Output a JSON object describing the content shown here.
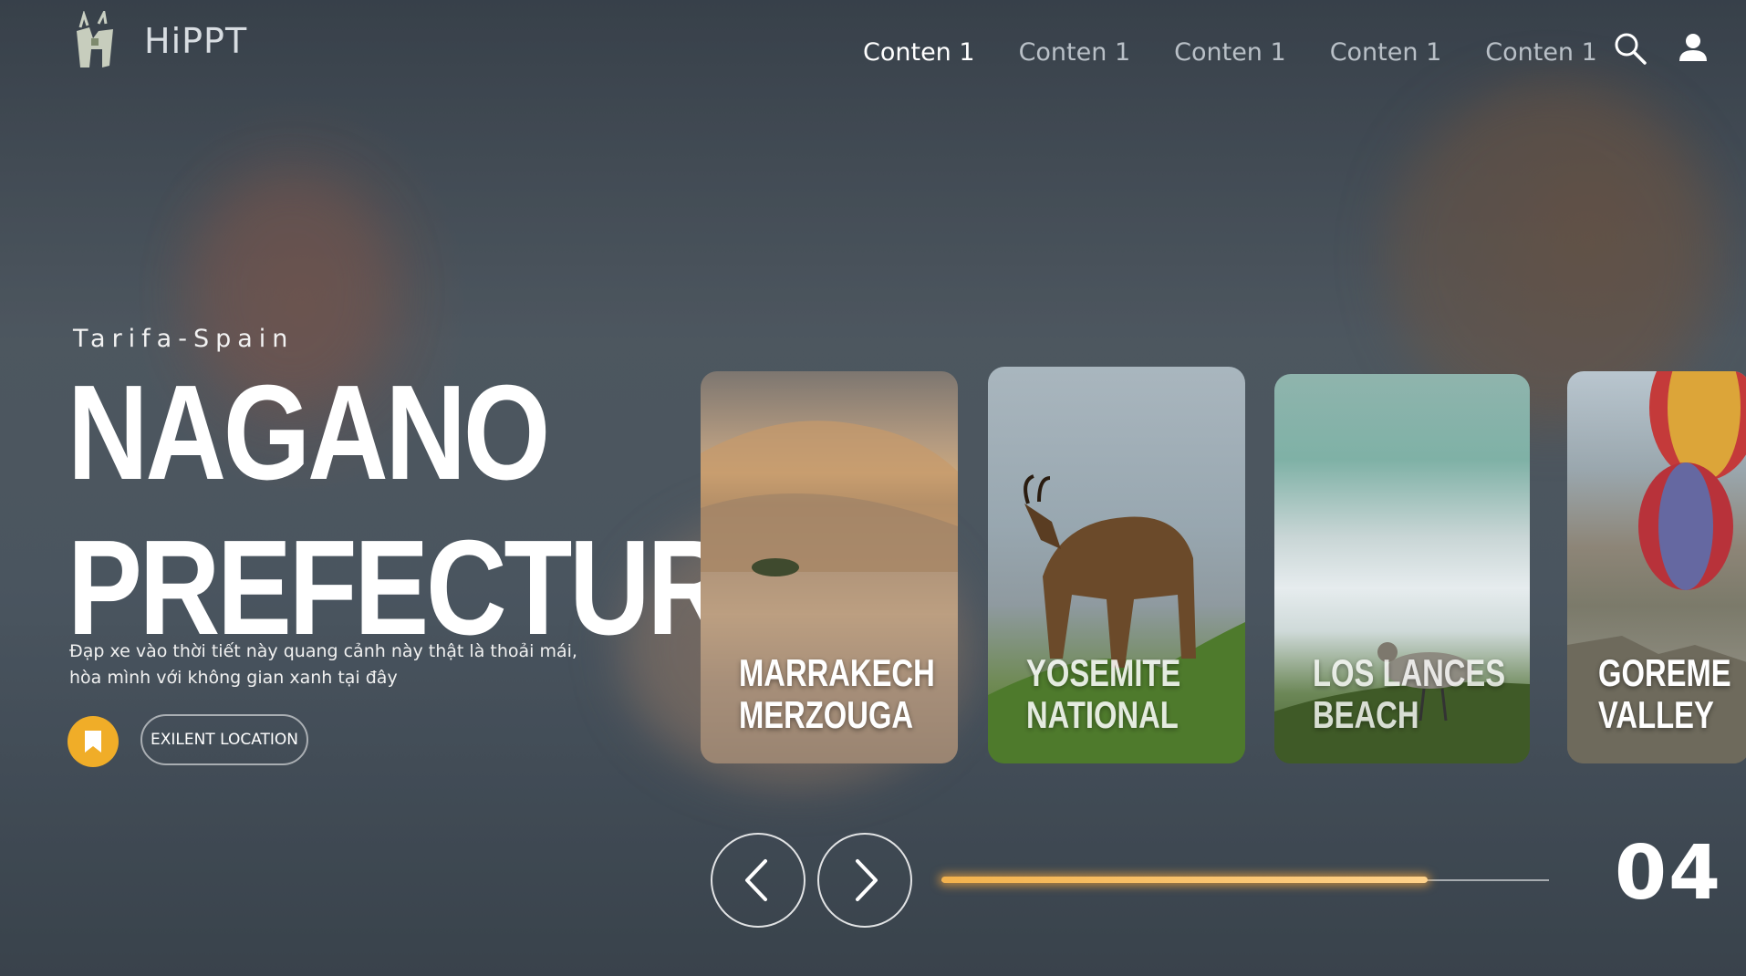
{
  "brand": {
    "name": "HiPPT",
    "logo_icon": "deer-logo-icon"
  },
  "nav": {
    "items": [
      {
        "label": "Conten 1",
        "active": true
      },
      {
        "label": "Conten 1",
        "active": false
      },
      {
        "label": "Conten 1",
        "active": false
      },
      {
        "label": "Conten 1",
        "active": false
      },
      {
        "label": "Conten 1",
        "active": false
      }
    ],
    "icons": [
      "search-icon",
      "user-icon"
    ]
  },
  "hero": {
    "subtitle": "Tarifa-Spain",
    "title_line1": "NAGANO",
    "title_line2": "PREFECTURE",
    "description_line1": "Đạp xe vào thời tiết này quang cảnh này thật là thoải mái,",
    "description_line2": "hòa mình với không gian xanh tại đây",
    "bookmark_icon": "bookmark-icon",
    "location_button": "EXILENT LOCATION"
  },
  "cards": [
    {
      "line1": "MARRAKECH",
      "line2": "MERZOUGA"
    },
    {
      "line1": "YOSEMITE",
      "line2": "NATIONAL"
    },
    {
      "line1": "LOS LANCES",
      "line2": "BEACH"
    },
    {
      "line1": "GOREME",
      "line2": "VALLEY"
    }
  ],
  "controls": {
    "prev_icon": "chevron-left-icon",
    "next_icon": "chevron-right-icon",
    "progress": 0.8,
    "counter": "04"
  },
  "colors": {
    "accent": "#f0ad28",
    "progress_glow": "#f3b24d"
  }
}
